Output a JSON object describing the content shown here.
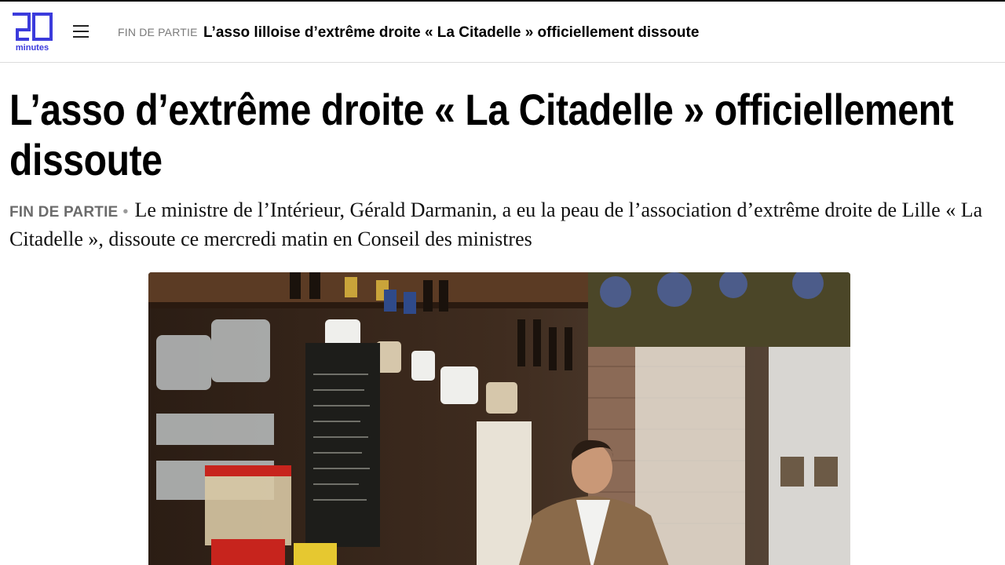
{
  "header": {
    "logo_number": "20",
    "logo_word": "minutes",
    "menu_icon": "hamburger-menu-icon",
    "section_label": "FIN DE PARTIE",
    "article_title": "L’asso lilloise d’extrême droite « La Citadelle » officiellement dissoute"
  },
  "article": {
    "headline": "L’asso d’extrême droite « La Citadelle » officiellement dissoute",
    "section_label": "FIN DE PARTIE",
    "separator": "•",
    "lead": "Le ministre de l’Intérieur, Gérald Darmanin, a eu la peau de l’association d’extrême droite de Lille « La Citadelle », dissoute ce mercredi matin en Conseil des ministres"
  },
  "colors": {
    "brand": "#3b3bdc",
    "section_gray": "#6b6b6b"
  }
}
